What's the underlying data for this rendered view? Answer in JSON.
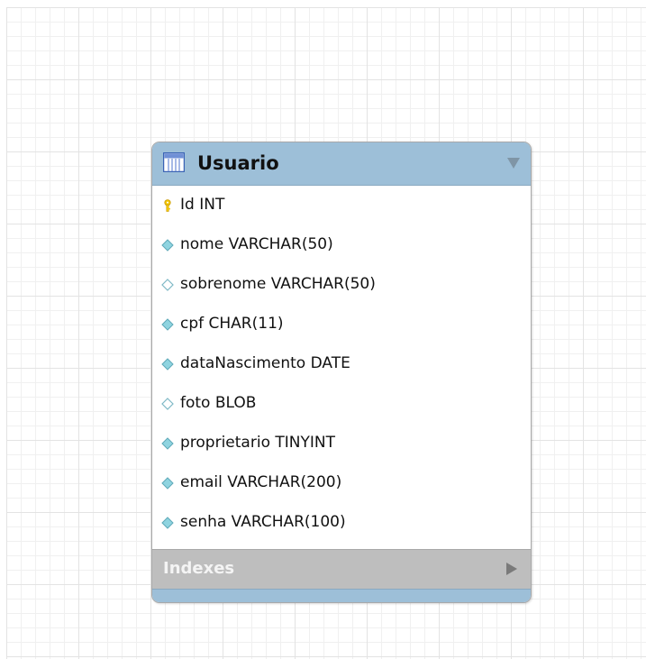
{
  "entity": {
    "title": "Usuario",
    "icon": "table-icon",
    "columns": [
      {
        "text": "Id INT",
        "icon": "primary-key-icon"
      },
      {
        "text": "nome VARCHAR(50)",
        "icon": "not-null-column-icon"
      },
      {
        "text": "sobrenome VARCHAR(50)",
        "icon": "nullable-column-icon"
      },
      {
        "text": "cpf CHAR(11)",
        "icon": "not-null-column-icon"
      },
      {
        "text": "dataNascimento DATE",
        "icon": "not-null-column-icon"
      },
      {
        "text": "foto BLOB",
        "icon": "nullable-column-icon"
      },
      {
        "text": "proprietario TINYINT",
        "icon": "not-null-column-icon"
      },
      {
        "text": "email VARCHAR(200)",
        "icon": "not-null-column-icon"
      },
      {
        "text": "senha VARCHAR(100)",
        "icon": "not-null-column-icon"
      }
    ],
    "indexes_label": "Indexes"
  },
  "colors": {
    "header": "#9dbfd8",
    "indexes_bar": "#bebebe",
    "filled_diamond": "#8fd4e0",
    "key": "#f2c200"
  }
}
